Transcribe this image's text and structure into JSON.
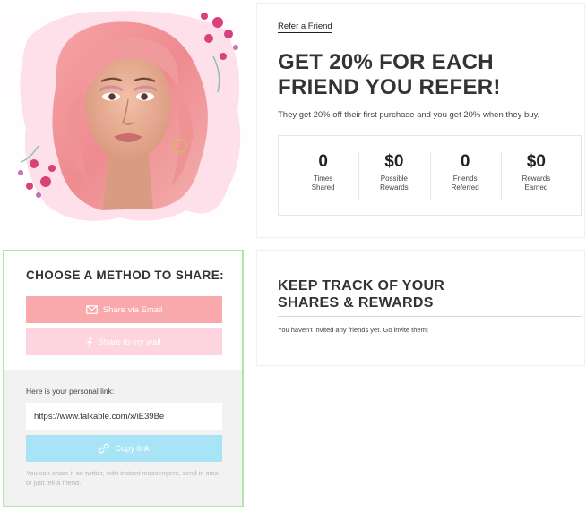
{
  "hero": {
    "image_alt": "Woman with pink hair and flowers"
  },
  "referral": {
    "link_label": "Refer a Friend",
    "headline_line1": "GET 20% FOR EACH",
    "headline_line2": "FRIEND YOU REFER!",
    "subheadline": "They get 20% off their first purchase and you get 20% when they buy.",
    "stats": [
      {
        "value": "0",
        "label_line1": "Times",
        "label_line2": "Shared"
      },
      {
        "value": "$0",
        "label_line1": "Possible",
        "label_line2": "Rewards"
      },
      {
        "value": "0",
        "label_line1": "Friends",
        "label_line2": "Referred"
      },
      {
        "value": "$0",
        "label_line1": "Rewards",
        "label_line2": "Earned"
      }
    ]
  },
  "share": {
    "title": "CHOOSE A METHOD TO SHARE:",
    "email_button": "Share via Email",
    "wall_button": "Share to my wall",
    "personal_link_label": "Here is your personal link:",
    "personal_link_value": "https://www.talkable.com/x/iE39Be",
    "copy_button": "Copy link",
    "hint": "You can share it on twitter, with instant messengers, send in sms or just tell a friend."
  },
  "tracking": {
    "title_line1": "KEEP TRACK OF YOUR",
    "title_line2": "SHARES & REWARDS",
    "empty_message": "You haven't invited any friends yet. Go invite them!"
  },
  "colors": {
    "email_button": "#f9a9ab",
    "wall_button": "#fdd4df",
    "copy_button": "#a8e4f6",
    "share_panel_border": "#aee6a8"
  },
  "icons": {
    "email": "envelope-icon",
    "wall": "facebook-icon",
    "copy": "link-icon"
  }
}
